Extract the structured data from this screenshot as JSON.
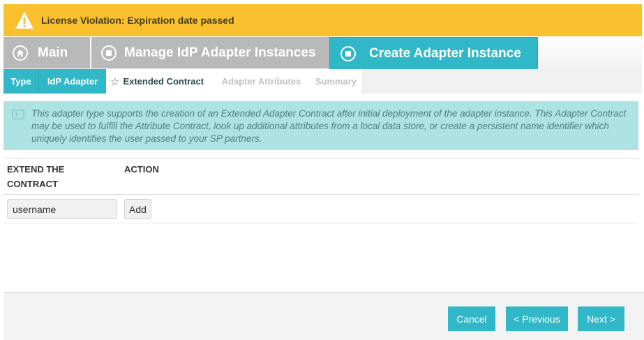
{
  "license_banner": {
    "icon": "warning-triangle-icon",
    "text": "License Violation: Expiration date passed",
    "color": "#fbc02d"
  },
  "breadcrumbs": [
    {
      "label": "Main",
      "icon": "home-icon"
    },
    {
      "label": "Manage IdP Adapter Instances",
      "icon": "stop-circle-icon"
    },
    {
      "label": "Create Adapter Instance",
      "icon": "stop-circle-icon",
      "active": true
    }
  ],
  "steps": [
    {
      "label": "Type",
      "state": "completed"
    },
    {
      "label": "IdP Adapter",
      "state": "completed"
    },
    {
      "label": "Extended Contract",
      "state": "current",
      "icon": "star-icon"
    },
    {
      "label": "Adapter Attributes",
      "state": "upcoming"
    },
    {
      "label": "Summary",
      "state": "upcoming"
    }
  ],
  "info": {
    "icon": "info-panel-icon",
    "text": "This adapter type supports the creation of an Extended Adapter Contract after initial deployment of the adapter instance. This Adapter Contract may be used to fulfill the Attribute Contract, look up additional attributes from a local data store, or create a persistent name identifier which uniquely identifies the user passed to your SP partners."
  },
  "table": {
    "columns": [
      "EXTEND THE CONTRACT",
      "ACTION"
    ],
    "input_value": "username",
    "add_label": "Add"
  },
  "footer": {
    "cancel": "Cancel",
    "previous": "< Previous",
    "next": "Next >"
  },
  "colors": {
    "accent": "#30b7c8",
    "breadcrumb_inactive": "#b9b9b9",
    "info_bg": "#ade3e3"
  }
}
